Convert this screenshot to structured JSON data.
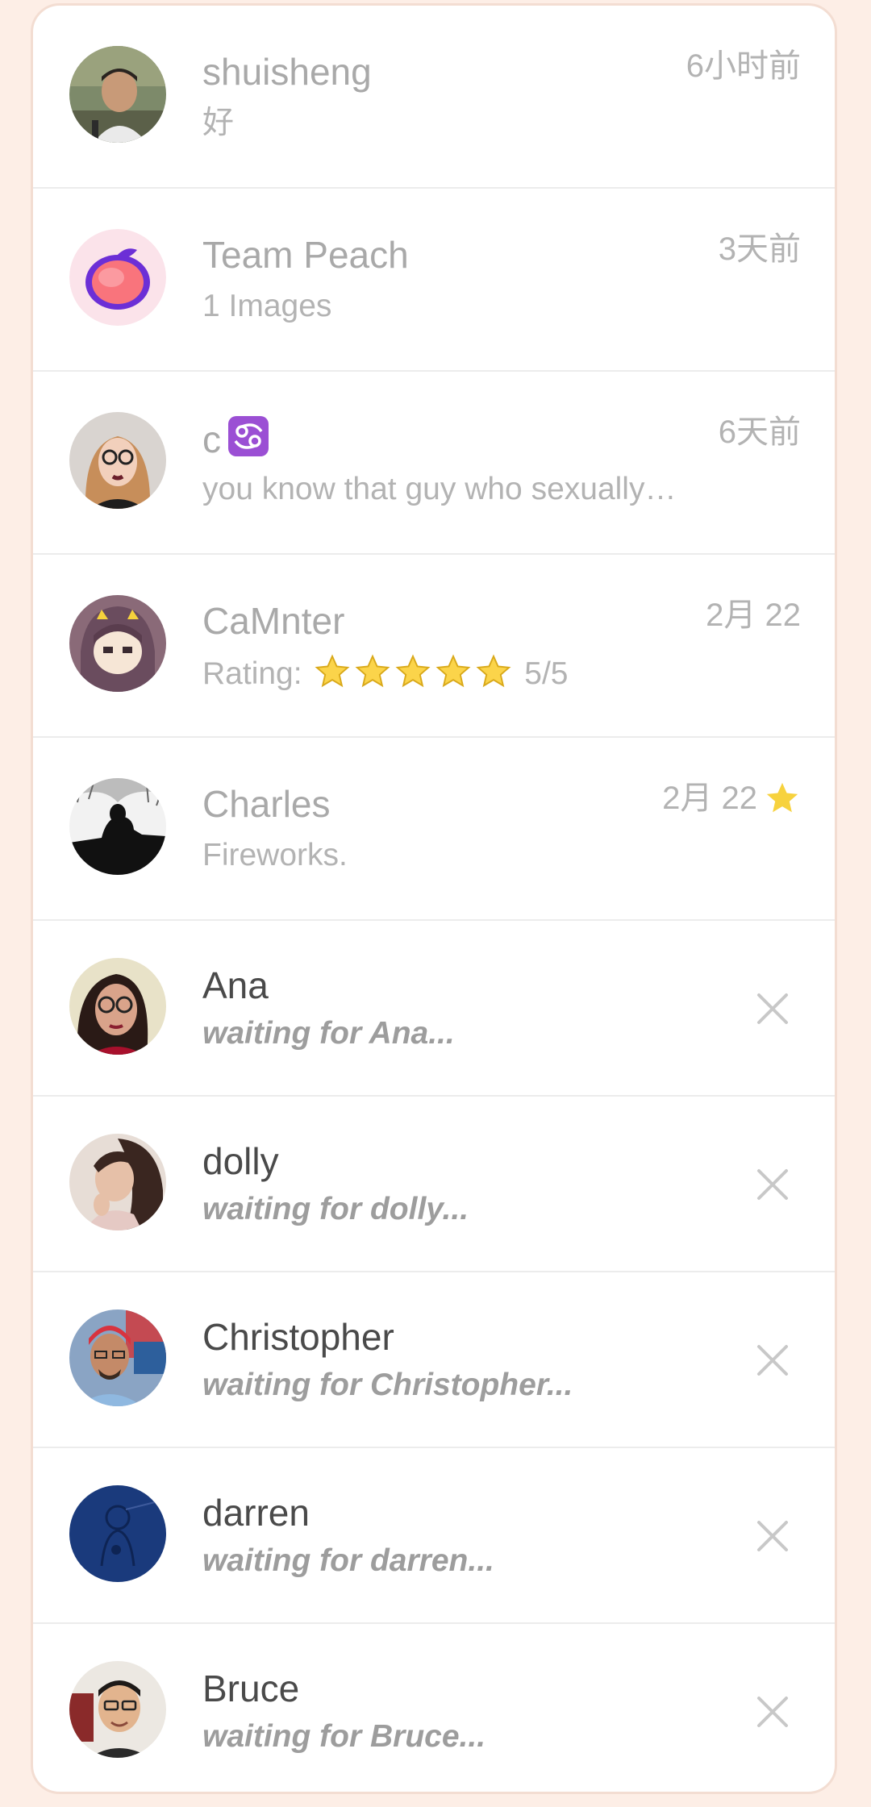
{
  "conversations": [
    {
      "name": "shuisheng",
      "preview": "好",
      "time": "6小时前",
      "avatar": "photo-man-outdoors"
    },
    {
      "name": "Team Peach",
      "preview": "1 Images",
      "time": "3天前",
      "avatar": "peach-logo-icon"
    },
    {
      "name": "c",
      "name_emoji": "cancer-zodiac-icon",
      "preview": "you know that guy who sexually…",
      "time": "6天前",
      "avatar": "photo-woman-glasses"
    },
    {
      "name": "CaMnter",
      "preview_label": "Rating:",
      "rating": 5,
      "rating_max": 5,
      "rating_text": "5/5",
      "time": "2月 22",
      "avatar": "anime-girl"
    },
    {
      "name": "Charles",
      "preview": "Fireworks.",
      "time": "2月 22",
      "starred": true,
      "avatar": "silhouette-photo"
    }
  ],
  "pending": [
    {
      "name": "Ana",
      "status": "waiting for Ana..."
    },
    {
      "name": "dolly",
      "status": "waiting for dolly..."
    },
    {
      "name": "Christopher",
      "status": "waiting for Christopher..."
    },
    {
      "name": "darren",
      "status": "waiting for darren..."
    },
    {
      "name": "Bruce",
      "status": "waiting for Bruce..."
    }
  ],
  "colors": {
    "page_background": "#fdeee6",
    "card_background": "#ffffff",
    "star_accent": "#f7d23e",
    "peach_purple": "#6c2fd6",
    "peach_pink": "#fbe3ea"
  }
}
